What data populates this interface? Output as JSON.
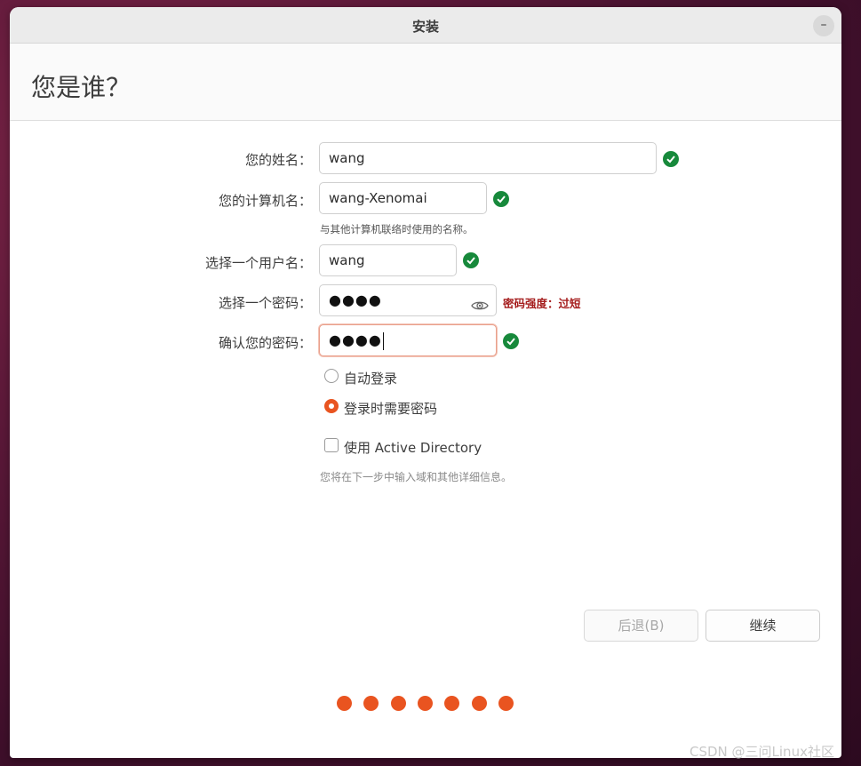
{
  "window": {
    "title": "安装",
    "minimize_label": "–"
  },
  "page": {
    "title": "您是谁？"
  },
  "form": {
    "name": {
      "label": "您的姓名：",
      "value": "wang"
    },
    "computer": {
      "label": "您的计算机名：",
      "value": "wang-Xenomai",
      "hint": "与其他计算机联络时使用的名称。"
    },
    "username": {
      "label": "选择一个用户名：",
      "value": "wang"
    },
    "password": {
      "label": "选择一个密码：",
      "value": "●●●●",
      "strength": "密码强度：过短"
    },
    "confirm": {
      "label": "确认您的密码：",
      "value": "●●●●"
    },
    "login_options": [
      {
        "label": "自动登录",
        "selected": false
      },
      {
        "label": "登录时需要密码",
        "selected": true
      }
    ],
    "active_directory": {
      "label": "使用 Active Directory",
      "checked": false,
      "hint": "您将在下一步中输入域和其他详细信息。"
    }
  },
  "buttons": {
    "back": "后退(B)",
    "continue": "继续"
  },
  "progress": {
    "steps": 7,
    "accent": "#e95420"
  },
  "colors": {
    "check": "#17893b",
    "warning": "#a51d1d"
  },
  "watermark": "CSDN @三问Linux社区"
}
